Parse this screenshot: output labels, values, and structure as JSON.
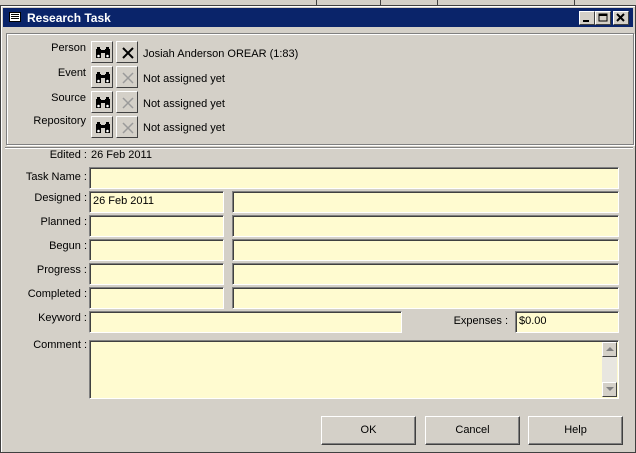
{
  "window": {
    "title": "Research Task"
  },
  "links": {
    "person": {
      "label": "Person",
      "value": "Josiah Anderson OREAR (1:83)"
    },
    "event": {
      "label": "Event",
      "value": "Not assigned yet"
    },
    "source": {
      "label": "Source",
      "value": "Not assigned yet"
    },
    "repository": {
      "label": "Repository",
      "value": "Not assigned yet"
    }
  },
  "edited": {
    "label": "Edited :",
    "value": "26 Feb 2011"
  },
  "task_name": {
    "label": "Task Name :",
    "value": ""
  },
  "dates": [
    {
      "label": "Designed :",
      "date": "26 Feb 2011",
      "note": ""
    },
    {
      "label": "Planned :",
      "date": "",
      "note": ""
    },
    {
      "label": "Begun :",
      "date": "",
      "note": ""
    },
    {
      "label": "Progress :",
      "date": "",
      "note": ""
    },
    {
      "label": "Completed :",
      "date": "",
      "note": ""
    }
  ],
  "keyword": {
    "label": "Keyword :",
    "value": ""
  },
  "expenses": {
    "label": "Expenses :",
    "value": "$0.00"
  },
  "comment": {
    "label": "Comment :",
    "value": ""
  },
  "buttons": {
    "ok": "OK",
    "cancel": "Cancel",
    "help": "Help"
  },
  "colors": {
    "field_bg": "#fffbd0",
    "titlebar": "#0a246a",
    "face": "#d4d0c8"
  },
  "icons": {
    "find": "binoculars-icon",
    "clear": "x-icon"
  }
}
